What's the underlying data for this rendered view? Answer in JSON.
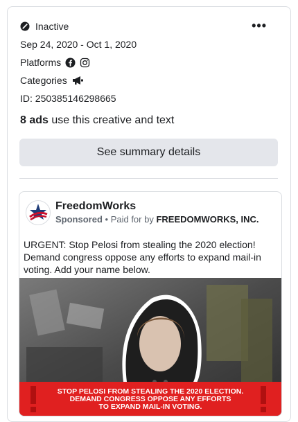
{
  "status": {
    "label": "Inactive",
    "icon": "no-entry-icon"
  },
  "more_label": "•••",
  "dates": "Sep 24, 2020 - Oct 1, 2020",
  "platforms": {
    "label": "Platforms",
    "icons": [
      "facebook-icon",
      "instagram-icon"
    ]
  },
  "categories": {
    "label": "Categories",
    "icon": "megaphone-icon"
  },
  "ad_id": "ID: 250385146298665",
  "ads_count": {
    "bold": "8 ads",
    "rest": " use this creative and text"
  },
  "summary_button": "See summary details",
  "ad": {
    "page_name": "FreedomWorks",
    "sponsored": "Sponsored",
    "separator": " • ",
    "paid_for_prefix": "Paid for by ",
    "payer": "FREEDOMWORKS, INC.",
    "body": "URGENT: Stop Pelosi from stealing the 2020 election! Demand congress oppose any efforts to expand mail-in voting. Add your name below.",
    "banner": {
      "line1": "STOP PELOSI FROM STEALING THE 2020 ELECTION.",
      "line2": "DEMAND CONGRESS OPPOSE ANY EFFORTS",
      "line3": "TO EXPAND MAIL-IN VOTING."
    }
  },
  "colors": {
    "banner_red": "#e02020",
    "button_bg": "#e4e6eb",
    "divider": "#dadde1"
  }
}
